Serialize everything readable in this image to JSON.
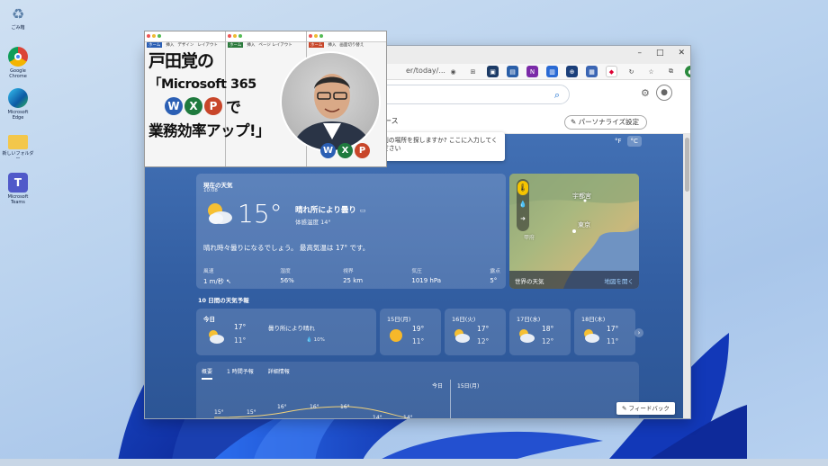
{
  "desktop": {
    "icons": [
      {
        "label": "ごみ箱",
        "icon": "recycle-bin-icon"
      },
      {
        "label": "Google Chrome",
        "icon": "chrome-icon"
      },
      {
        "label": "Microsoft Edge",
        "icon": "edge-icon"
      },
      {
        "label": "新しいフォルダー",
        "icon": "folder-icon"
      },
      {
        "label": "Microsoft Teams",
        "icon": "teams-icon"
      }
    ]
  },
  "browser": {
    "url": "er/today/...",
    "window_controls": [
      "–",
      "□",
      "✕"
    ],
    "personalize_label": "パーソナライズ設定",
    "nav_news": "ース"
  },
  "location_tip": "別の場所を探しますか? ここに入力してください",
  "units": {
    "f": "°F",
    "c": "°C"
  },
  "current": {
    "heading": "現在の天気",
    "time": "10:08",
    "temp": "15°",
    "condition": "晴れ所により曇り",
    "feels_like": "体感温度  14°",
    "summary": "晴れ時々曇りになるでしょう。 最高気温は 17° です。",
    "stats": [
      {
        "key": "風速",
        "value": "1 m/秒 ↖"
      },
      {
        "key": "湿度",
        "value": "56%"
      },
      {
        "key": "視界",
        "value": "25 km"
      },
      {
        "key": "気圧",
        "value": "1019 hPa"
      },
      {
        "key": "露点",
        "value": "5°"
      }
    ]
  },
  "map": {
    "label_utsunomiya": "宇都宮",
    "label_tokyo": "東京",
    "label_kofu": "甲府",
    "footer_left": "世界の天気",
    "footer_right": "地図を開く"
  },
  "forecast": {
    "title": "10 日間の天気予報",
    "today": {
      "label": "今日",
      "hi": "17°",
      "lo": "11°",
      "condition": "曇り所により晴れ",
      "rain": "💧 10%"
    },
    "days": [
      {
        "label": "15日(月)",
        "hi": "19°",
        "lo": "11°",
        "icon": "sun-icon"
      },
      {
        "label": "16日(火)",
        "hi": "17°",
        "lo": "12°",
        "icon": "partly-cloudy-icon"
      },
      {
        "label": "17日(水)",
        "hi": "18°",
        "lo": "12°",
        "icon": "partly-cloudy-icon"
      },
      {
        "label": "18日(木)",
        "hi": "17°",
        "lo": "11°",
        "icon": "partly-cloudy-icon"
      }
    ]
  },
  "chart": {
    "tabs": [
      "概要",
      "1 時間予報",
      "詳細情報"
    ],
    "today_label": "今日",
    "next_label": "15日(月)",
    "temps": [
      "15°",
      "15°",
      "16°",
      "16°",
      "16°",
      "14°",
      "14°"
    ]
  },
  "feedback_label": "フィードバック",
  "promo": {
    "line1": "戸田覚の",
    "line2": "「Microsoft 365",
    "line2b": "で",
    "line3": "業務効率アップ!」",
    "ribbon_tabs_1": [
      "ホーム",
      "挿入",
      "デザイン",
      "レイアウト"
    ],
    "ribbon_tabs_2": [
      "ホーム",
      "挿入",
      "ページ レイアウト"
    ],
    "ribbon_tabs_3": [
      "ホーム",
      "挿入",
      "画面切り替え"
    ],
    "w": "W",
    "x": "X",
    "p": "P"
  },
  "colors": {
    "word": "#2b5fb4",
    "excel": "#1f7a3e",
    "ppt": "#c8462a",
    "weather_bg": "#3a66ab"
  }
}
